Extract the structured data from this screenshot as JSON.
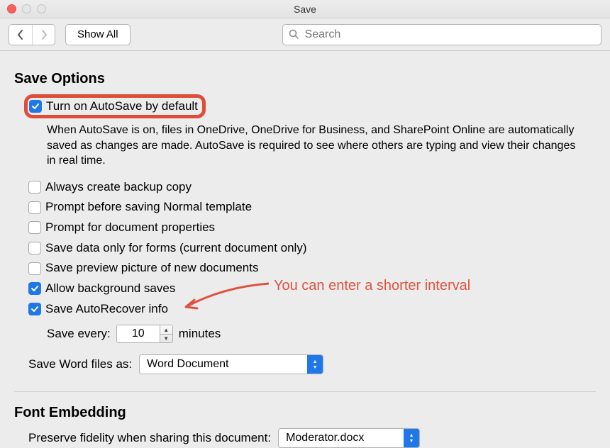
{
  "window": {
    "title": "Save"
  },
  "toolbar": {
    "show_all": "Show All",
    "search_placeholder": "Search"
  },
  "sections": {
    "save_options": {
      "title": "Save Options",
      "autosave": {
        "label": "Turn on AutoSave by default",
        "checked": true,
        "description": "When AutoSave is on, files in OneDrive, OneDrive for Business, and SharePoint Online are automatically saved as changes are made. AutoSave is required to see where others are typing and view their changes in real time."
      },
      "backup_copy": {
        "label": "Always create backup copy",
        "checked": false
      },
      "prompt_normal": {
        "label": "Prompt before saving Normal template",
        "checked": false
      },
      "prompt_props": {
        "label": "Prompt for document properties",
        "checked": false
      },
      "forms_only": {
        "label": "Save data only for forms (current document only)",
        "checked": false
      },
      "preview_pic": {
        "label": "Save preview picture of new documents",
        "checked": false
      },
      "bg_saves": {
        "label": "Allow background saves",
        "checked": true
      },
      "autorecover": {
        "label": "Save AutoRecover info",
        "checked": true
      },
      "save_every": {
        "label_prefix": "Save every:",
        "value": "10",
        "label_suffix": "minutes"
      },
      "save_as": {
        "label": "Save Word files as:",
        "value": "Word Document"
      }
    },
    "font_embedding": {
      "title": "Font Embedding",
      "preserve": {
        "label": "Preserve fidelity when sharing this document:",
        "value": "Moderator.docx"
      }
    }
  },
  "annotation": {
    "text": "You can enter a shorter interval"
  }
}
